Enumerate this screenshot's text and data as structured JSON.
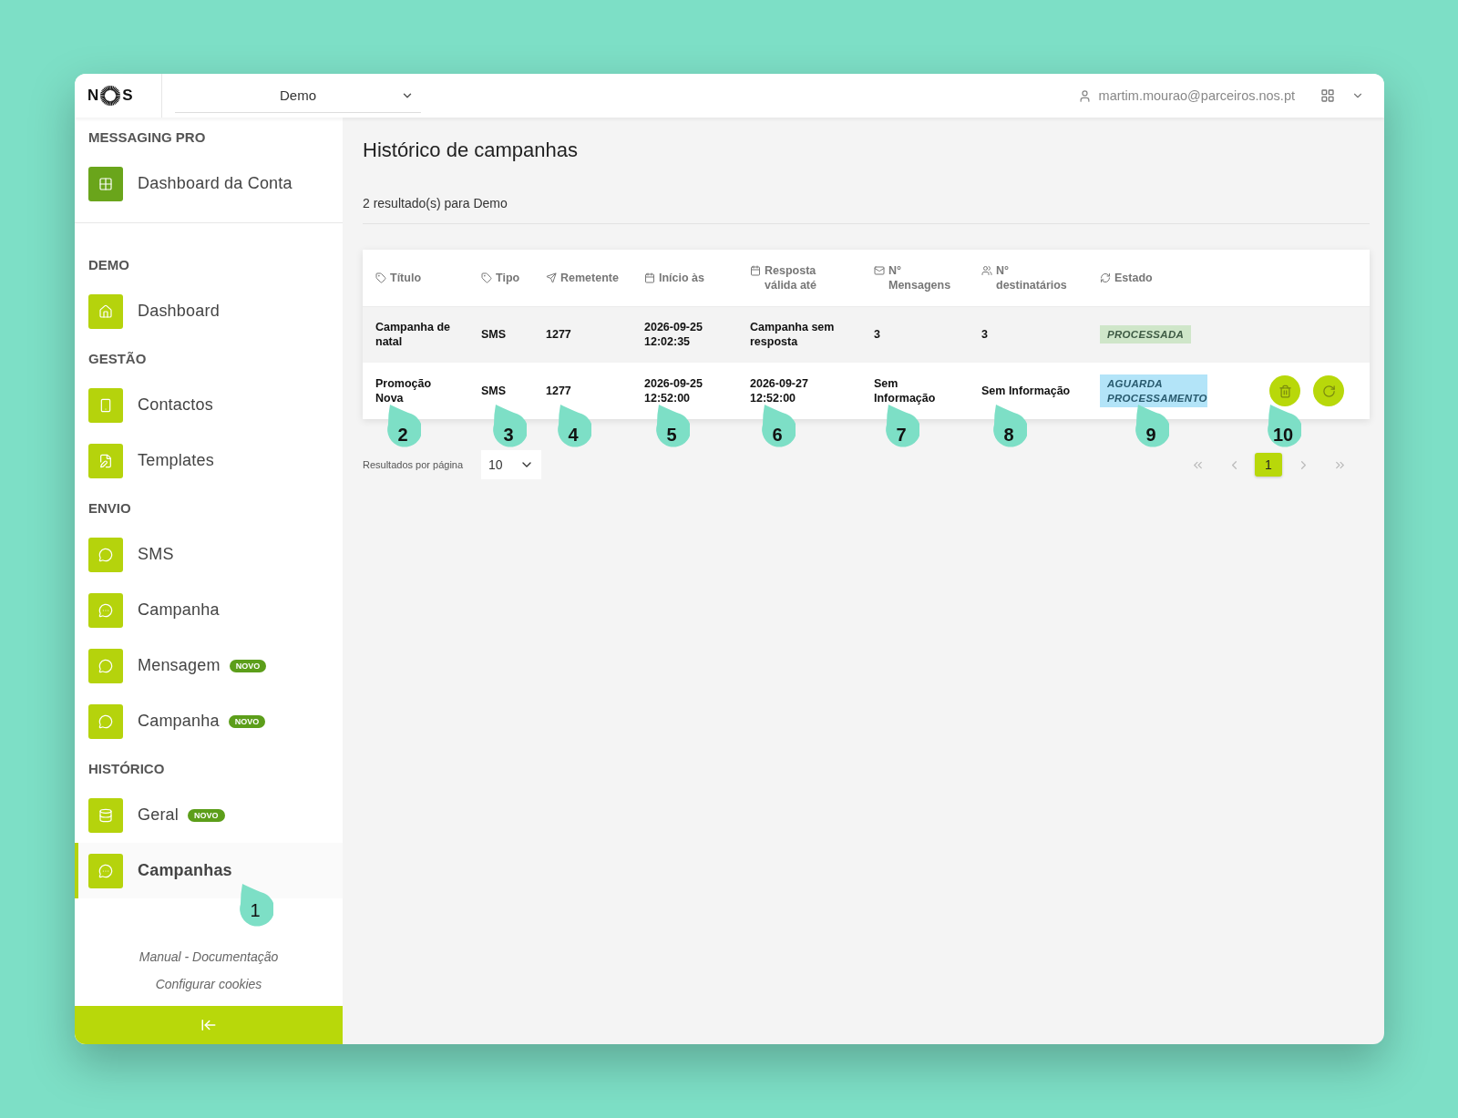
{
  "topbar": {
    "logo_letters": [
      "N",
      "S"
    ],
    "account_select": "Demo",
    "user_email": "martim.mourao@parceiros.nos.pt"
  },
  "sidebar": {
    "sections": [
      {
        "title": "MESSAGING PRO",
        "items": [
          {
            "label": "Dashboard da Conta",
            "kind": "primary",
            "selected": false
          }
        ]
      },
      {
        "title": "DEMO",
        "items": [
          {
            "label": "Dashboard",
            "kind": "standard",
            "selected": false
          }
        ]
      },
      {
        "title": "GESTÃO",
        "items": [
          {
            "label": "Contactos",
            "kind": "standard",
            "selected": false
          },
          {
            "label": "Templates",
            "kind": "standard",
            "selected": false
          }
        ]
      },
      {
        "title": "ENVIO",
        "items": [
          {
            "label": "SMS",
            "kind": "standard",
            "selected": false
          },
          {
            "label": "Campanha",
            "kind": "standard",
            "selected": false
          },
          {
            "label": "Mensagem",
            "kind": "standard",
            "selected": false,
            "badge": "NOVO"
          },
          {
            "label": "Campanha",
            "kind": "standard",
            "selected": false,
            "badge": "NOVO"
          }
        ]
      },
      {
        "title": "HISTÓRICO",
        "items": [
          {
            "label": "Geral",
            "kind": "standard",
            "selected": false,
            "badge": "NOVO"
          },
          {
            "label": "Campanhas",
            "kind": "standard",
            "selected": true,
            "callout": "1"
          }
        ]
      }
    ],
    "links": [
      "Manual - Documentação",
      "Configurar cookies"
    ]
  },
  "page": {
    "title": "Histórico de campanhas",
    "result_summary": "2 resultado(s) para Demo"
  },
  "table": {
    "columns": [
      {
        "label": "Título"
      },
      {
        "label": "Tipo"
      },
      {
        "label": "Remetente"
      },
      {
        "label": "Início às"
      },
      {
        "label": "Resposta válida até"
      },
      {
        "label": "N° Mensagens"
      },
      {
        "label": "N° destinatários"
      },
      {
        "label": "Estado"
      }
    ],
    "callout_markers": [
      "2",
      "3",
      "4",
      "5",
      "6",
      "7",
      "8",
      "9",
      "10"
    ],
    "rows": [
      {
        "cells": [
          "Campanha de natal",
          "SMS",
          "1277",
          "2026-09-25 12:02:35",
          "Campanha sem resposta",
          "3",
          "3"
        ],
        "status": {
          "label": "PROCESSADA",
          "kind": "done"
        },
        "actions": false
      },
      {
        "cells": [
          "Promoção Nova",
          "SMS",
          "1277",
          "2026-09-25 12:52:00",
          "2026-09-27 12:52:00",
          "Sem Informação",
          "Sem Informação"
        ],
        "status": {
          "label": "AGUARDA PROCESSAMENTO",
          "kind": "pending"
        },
        "actions": true
      }
    ]
  },
  "pagination": {
    "page_size_label": "Resultados por página",
    "page_size": "10",
    "pages": [
      {
        "label": "1",
        "selected": true
      }
    ]
  }
}
